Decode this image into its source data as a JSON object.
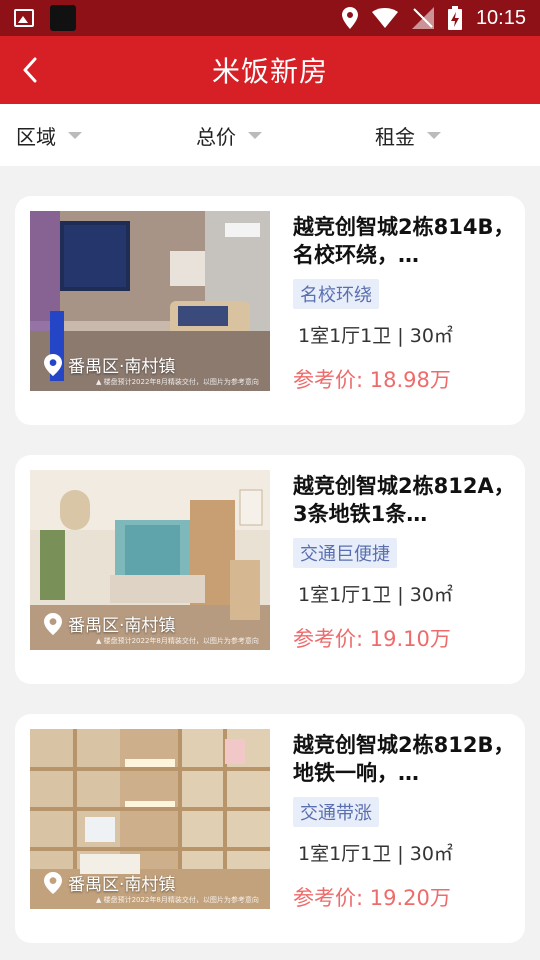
{
  "status_bar": {
    "time": "10:15"
  },
  "app_bar": {
    "title": "米饭新房"
  },
  "filters": [
    {
      "label": "区域"
    },
    {
      "label": "总价"
    },
    {
      "label": "租金"
    }
  ],
  "listings": [
    {
      "title": "越竞创智城2栋814B，名校环绕，…",
      "tag": "名校环绕",
      "specs": "1室1厅1卫 | 30㎡",
      "price": "参考价: 18.98万",
      "location": "番禺区·南村镇",
      "watermark": "▲ 楼盘预计2022年8月精装交付，以图片为参考意向"
    },
    {
      "title": "越竞创智城2栋812A，3条地铁1条…",
      "tag": "交通巨便捷",
      "specs": "1室1厅1卫 | 30㎡",
      "price": "参考价: 19.10万",
      "location": "番禺区·南村镇",
      "watermark": "▲ 楼盘预计2022年8月精装交付，以图片为参考意向"
    },
    {
      "title": "越竞创智城2栋812B，地铁一响，…",
      "tag": "交通带涨",
      "specs": "1室1厅1卫 | 30㎡",
      "price": "参考价: 19.20万",
      "location": "番禺区·南村镇",
      "watermark": "▲ 楼盘预计2022年8月精装交付，以图片为参考意向"
    }
  ],
  "colors": {
    "status_bar": "#8e1117",
    "app_bar": "#d71f26",
    "price": "#ee6b6b",
    "tag_bg": "#e8eef9",
    "tag_text": "#5a6fb0"
  }
}
